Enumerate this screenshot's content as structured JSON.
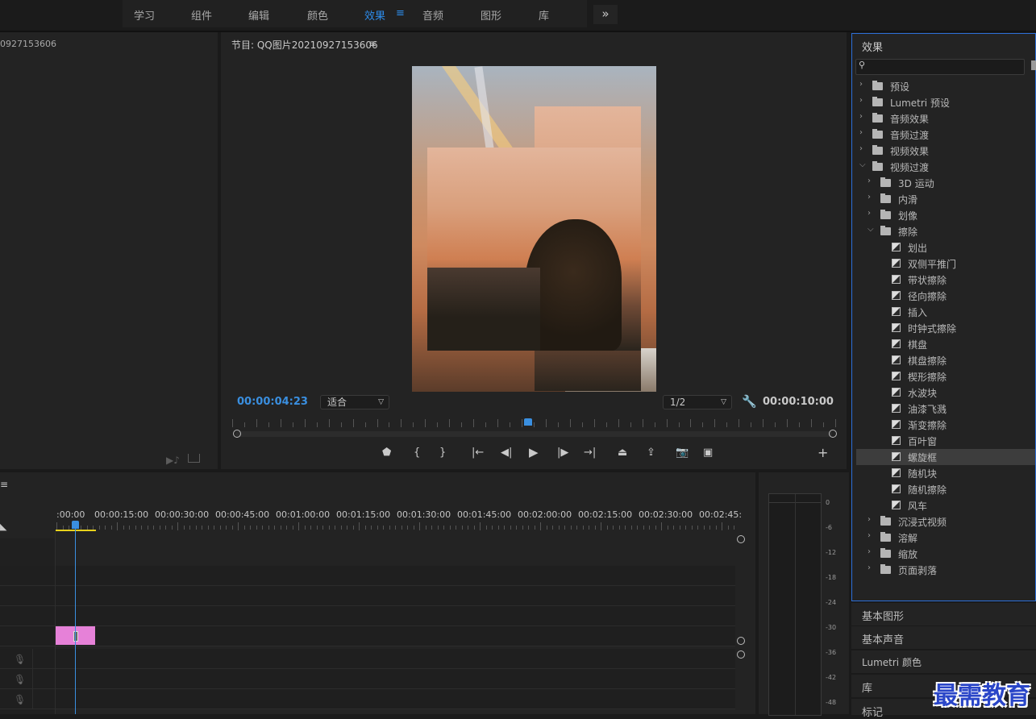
{
  "workspace_tabs": [
    "学习",
    "组件",
    "编辑",
    "颜色",
    "效果",
    "音频",
    "图形",
    "库"
  ],
  "workspace_active": "效果",
  "workspace_menu_icon": "≡",
  "workspace_more_icon": "»",
  "source_panel": {
    "title_fragment": "0927153606"
  },
  "program_panel": {
    "title": "节目: QQ图片20210927153606",
    "menu_icon": "≡",
    "current_timecode": "00:00:04:23",
    "zoom_select": "适合",
    "resolution_select": "1/2",
    "duration_timecode": "00:00:10:00",
    "playhead_fraction": 0.49,
    "controls": {
      "marker": "⬤",
      "in_point": "{",
      "out_point": "}",
      "go_in": "|←",
      "step_back": "◀|",
      "play": "▶",
      "step_forward": "|▶",
      "go_out": "→|",
      "lift": "⏏",
      "extract": "⇪",
      "export_frame": "📷",
      "compare": "▣",
      "add": "+"
    }
  },
  "effects_panel": {
    "title": "效果",
    "search_placeholder": "",
    "tree": [
      {
        "label": "预设",
        "level": 0,
        "kind": "folder",
        "state": "collapsed"
      },
      {
        "label": "Lumetri 预设",
        "level": 0,
        "kind": "folder",
        "state": "collapsed"
      },
      {
        "label": "音频效果",
        "level": 0,
        "kind": "folder",
        "state": "collapsed"
      },
      {
        "label": "音频过渡",
        "level": 0,
        "kind": "folder",
        "state": "collapsed"
      },
      {
        "label": "视频效果",
        "level": 0,
        "kind": "folder",
        "state": "collapsed"
      },
      {
        "label": "视频过渡",
        "level": 0,
        "kind": "folder",
        "state": "expanded"
      },
      {
        "label": "3D 运动",
        "level": 1,
        "kind": "folder",
        "state": "collapsed"
      },
      {
        "label": "内滑",
        "level": 1,
        "kind": "folder",
        "state": "collapsed"
      },
      {
        "label": "划像",
        "level": 1,
        "kind": "folder",
        "state": "collapsed"
      },
      {
        "label": "擦除",
        "level": 1,
        "kind": "folder",
        "state": "expanded"
      },
      {
        "label": "划出",
        "level": 2,
        "kind": "effect"
      },
      {
        "label": "双侧平推门",
        "level": 2,
        "kind": "effect"
      },
      {
        "label": "带状擦除",
        "level": 2,
        "kind": "effect"
      },
      {
        "label": "径向擦除",
        "level": 2,
        "kind": "effect"
      },
      {
        "label": "插入",
        "level": 2,
        "kind": "effect"
      },
      {
        "label": "时钟式擦除",
        "level": 2,
        "kind": "effect"
      },
      {
        "label": "棋盘",
        "level": 2,
        "kind": "effect"
      },
      {
        "label": "棋盘擦除",
        "level": 2,
        "kind": "effect"
      },
      {
        "label": "楔形擦除",
        "level": 2,
        "kind": "effect"
      },
      {
        "label": "水波块",
        "level": 2,
        "kind": "effect"
      },
      {
        "label": "油漆飞溅",
        "level": 2,
        "kind": "effect"
      },
      {
        "label": "渐变擦除",
        "level": 2,
        "kind": "effect"
      },
      {
        "label": "百叶窗",
        "level": 2,
        "kind": "effect"
      },
      {
        "label": "螺旋框",
        "level": 2,
        "kind": "effect",
        "selected": true
      },
      {
        "label": "随机块",
        "level": 2,
        "kind": "effect"
      },
      {
        "label": "随机擦除",
        "level": 2,
        "kind": "effect"
      },
      {
        "label": "风车",
        "level": 2,
        "kind": "effect"
      },
      {
        "label": "沉浸式视频",
        "level": 1,
        "kind": "folder",
        "state": "collapsed"
      },
      {
        "label": "溶解",
        "level": 1,
        "kind": "folder",
        "state": "collapsed"
      },
      {
        "label": "缩放",
        "level": 1,
        "kind": "folder",
        "state": "collapsed"
      },
      {
        "label": "页面剥落",
        "level": 1,
        "kind": "folder",
        "state": "collapsed"
      }
    ]
  },
  "side_panels": [
    "基本图形",
    "基本声音",
    "Lumetri 颜色",
    "库",
    "标记"
  ],
  "timeline": {
    "menu_icon": "≡",
    "ruler_labels": [
      ":00:00",
      "00:00:15:00",
      "00:00:30:00",
      "00:00:45:00",
      "00:01:00:00",
      "00:01:15:00",
      "00:01:30:00",
      "00:01:45:00",
      "00:02:00:00",
      "00:02:15:00",
      "00:02:30:00",
      "00:02:45:"
    ],
    "clip_color": "#e681d8"
  },
  "audio_meter": {
    "scale": [
      "0",
      "-6",
      "-12",
      "-18",
      "-24",
      "-30",
      "-36",
      "-42",
      "-48"
    ]
  },
  "watermark": "最需教育",
  "colors": {
    "accent": "#2d8ceb",
    "timecode": "#3a8fe0",
    "selected_row": "#3d3d3d",
    "in_out_bar": "#e8d21c"
  }
}
